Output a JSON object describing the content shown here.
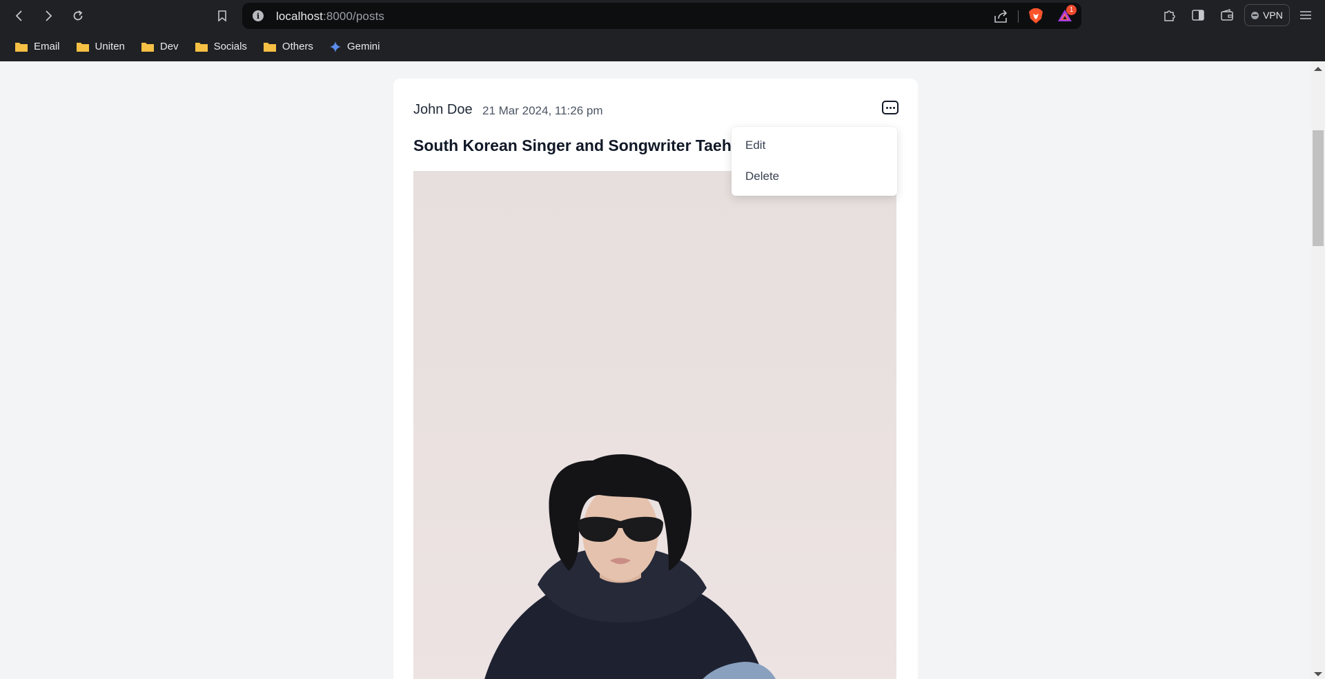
{
  "browser": {
    "url_host": "localhost",
    "url_rest": ":8000/posts",
    "rewards_badge": "1",
    "vpn_label": "VPN"
  },
  "bookmarks": [
    {
      "label": "Email",
      "icon": "folder-icon"
    },
    {
      "label": "Uniten",
      "icon": "folder-icon"
    },
    {
      "label": "Dev",
      "icon": "folder-icon"
    },
    {
      "label": "Socials",
      "icon": "folder-icon"
    },
    {
      "label": "Others",
      "icon": "folder-icon"
    },
    {
      "label": "Gemini",
      "icon": "gemini-sparkle-icon"
    }
  ],
  "post": {
    "author": "John Doe",
    "date": "21 Mar 2024, 11:26 pm",
    "title": "South Korean Singer and Songwriter Taehyung",
    "image": "portrait-photo"
  },
  "post_menu": {
    "items": [
      "Edit",
      "Delete"
    ]
  },
  "colors": {
    "chrome_bg": "#202124",
    "page_bg": "#f3f4f6",
    "card_bg": "#ffffff",
    "brave_orange": "#fb542b",
    "folder_yellow": "#f5c044"
  }
}
